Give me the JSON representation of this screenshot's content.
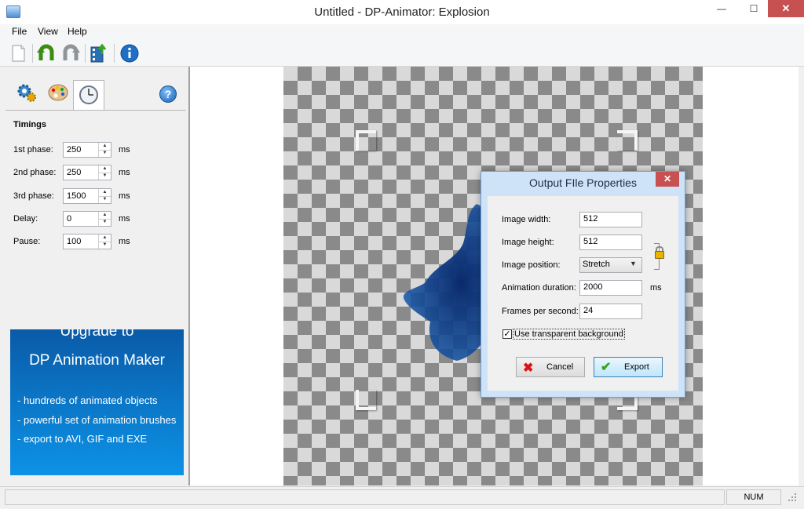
{
  "window": {
    "title": "Untitled - DP-Animator: Explosion",
    "min": "—",
    "max": "☐",
    "close": "✕"
  },
  "menu": [
    "File",
    "View",
    "Help"
  ],
  "panel": {
    "section_title": "Timings",
    "rows": [
      {
        "label": "1st phase:",
        "value": "250",
        "unit": "ms"
      },
      {
        "label": "2nd phase:",
        "value": "250",
        "unit": "ms"
      },
      {
        "label": "3rd phase:",
        "value": "1500",
        "unit": "ms"
      },
      {
        "label": "Delay:",
        "value": "0",
        "unit": "ms"
      },
      {
        "label": "Pause:",
        "value": "100",
        "unit": "ms"
      }
    ],
    "help": "?"
  },
  "promo": {
    "line1": "Upgrade to",
    "line2": "DP Animation Maker",
    "features": [
      "- hundreds of animated objects",
      "- powerful set of animation brushes",
      "- export to AVI, GIF and EXE"
    ]
  },
  "dialog": {
    "title": "Output FIle Properties",
    "close": "✕",
    "width_label": "Image width:",
    "width_value": "512",
    "height_label": "Image height:",
    "height_value": "512",
    "position_label": "Image position:",
    "position_value": "Stretch",
    "duration_label": "Animation duration:",
    "duration_value": "2000",
    "duration_unit": "ms",
    "fps_label": "Frames per second:",
    "fps_value": "24",
    "checkbox_label": "Use transparent background",
    "checkbox_checked": "✓",
    "cancel": "Cancel",
    "export": "Export"
  },
  "status": {
    "num": "NUM"
  }
}
